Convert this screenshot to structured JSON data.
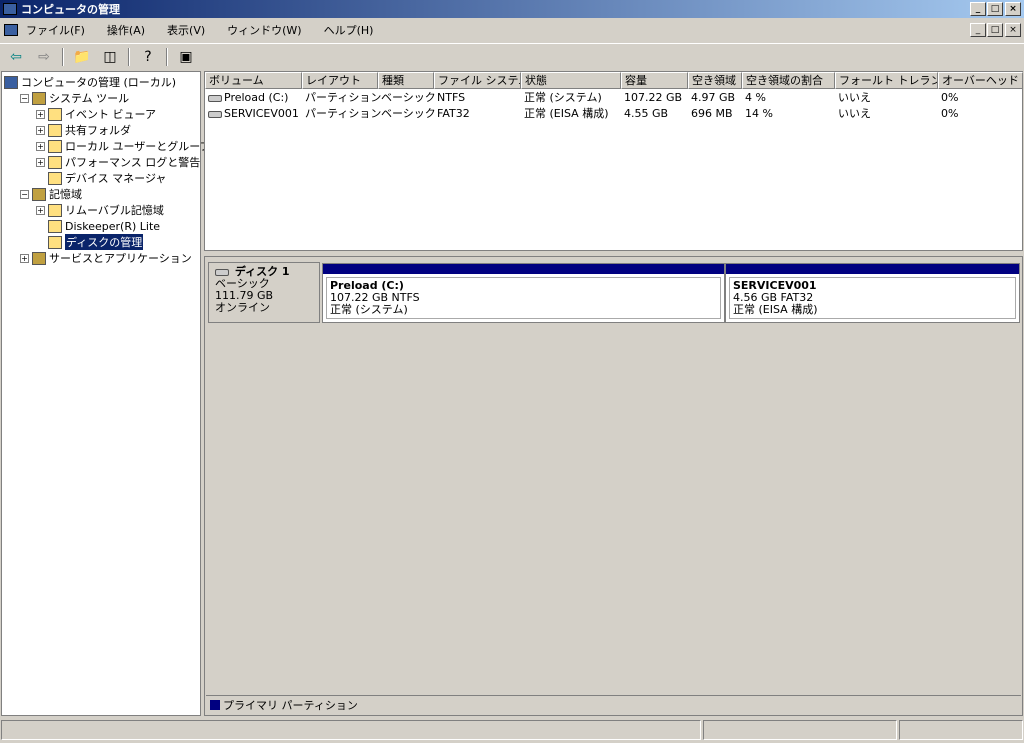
{
  "window": {
    "title": "コンピュータの管理"
  },
  "menu": [
    "ファイル(F)",
    "操作(A)",
    "表示(V)",
    "ウィンドウ(W)",
    "ヘルプ(H)"
  ],
  "tree": [
    {
      "label": "コンピュータの管理 (ローカル)",
      "level": 0,
      "expander": ""
    },
    {
      "label": "システム ツール",
      "level": 1,
      "expander": "−"
    },
    {
      "label": "イベント ビューア",
      "level": 2,
      "expander": "+"
    },
    {
      "label": "共有フォルダ",
      "level": 2,
      "expander": "+"
    },
    {
      "label": "ローカル ユーザーとグループ",
      "level": 2,
      "expander": "+"
    },
    {
      "label": "パフォーマンス ログと警告",
      "level": 2,
      "expander": "+"
    },
    {
      "label": "デバイス マネージャ",
      "level": 2,
      "expander": ""
    },
    {
      "label": "記憶域",
      "level": 1,
      "expander": "−"
    },
    {
      "label": "リムーバブル記憶域",
      "level": 2,
      "expander": "+"
    },
    {
      "label": "Diskeeper(R) Lite",
      "level": 2,
      "expander": ""
    },
    {
      "label": "ディスクの管理",
      "level": 2,
      "expander": "",
      "selected": true
    },
    {
      "label": "サービスとアプリケーション",
      "level": 1,
      "expander": "+"
    }
  ],
  "volumes": {
    "headers": [
      "ボリューム",
      "レイアウト",
      "種類",
      "ファイル システム",
      "状態",
      "容量",
      "空き領域",
      "空き領域の割合",
      "フォールト トレランス",
      "オーバーヘッド"
    ],
    "rows": [
      [
        "Preload (C:)",
        "パーティション",
        "ベーシック",
        "NTFS",
        "正常 (システム)",
        "107.22 GB",
        "4.97 GB",
        "4 %",
        "いいえ",
        "0%"
      ],
      [
        "SERVICEV001",
        "パーティション",
        "ベーシック",
        "FAT32",
        "正常 (EISA 構成)",
        "4.55 GB",
        "696 MB",
        "14 %",
        "いいえ",
        "0%"
      ]
    ]
  },
  "disk": {
    "name": "ディスク 1",
    "type": "ベーシック",
    "size": "111.79 GB",
    "status": "オンライン",
    "partitions": [
      {
        "name": "Preload (C:)",
        "size": "107.22 GB NTFS",
        "status": "正常 (システム)"
      },
      {
        "name": "SERVICEV001",
        "size": "4.56 GB FAT32",
        "status": "正常 (EISA 構成)"
      }
    ]
  },
  "legend": {
    "label": "プライマリ パーティション",
    "color": "#000080"
  }
}
